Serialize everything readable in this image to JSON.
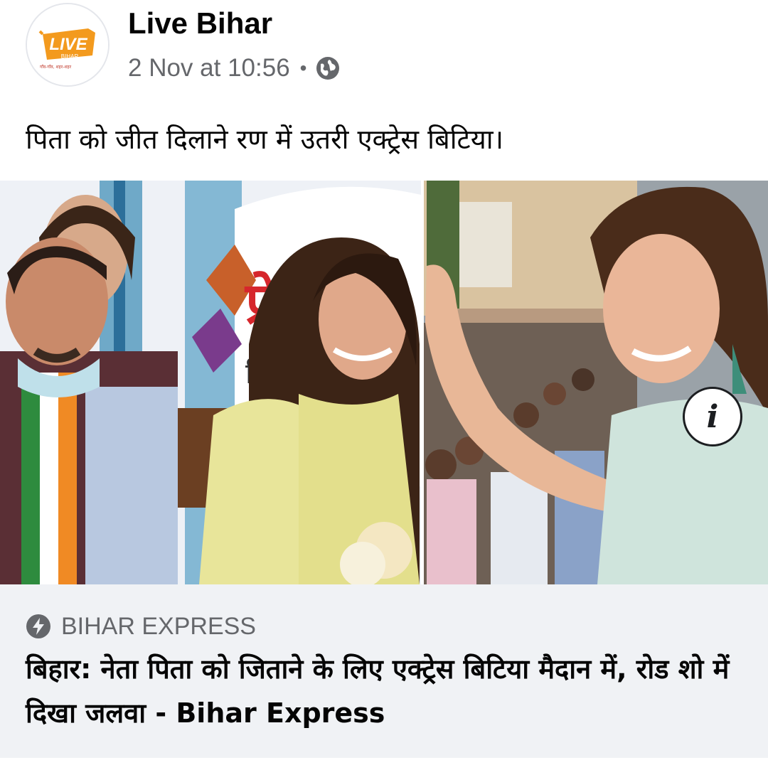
{
  "page": {
    "name": "Live Bihar",
    "timestamp": "2 Nov at 10:56",
    "separator": "•",
    "privacy_icon": "globe-icon",
    "logo_text": "LIVE",
    "logo_subtext": "BIHAR",
    "logo_tagline": "गाँव-गाँव, शहर-शहर"
  },
  "post": {
    "caption": "पिता को जीत दिलाने रण में उतरी एक्ट्रेस बिटिया।"
  },
  "media": {
    "info_button": "i"
  },
  "link": {
    "source_icon": "lightning-icon",
    "source": "BIHAR EXPRESS",
    "title": "बिहार: नेता पिता को जिताने के लिए एक्ट्रेस बिटिया मैदान में, रोड शो में दिखा जलवा - Bihar Express"
  },
  "colors": {
    "logo_orange": "#f39a1e",
    "link_bg": "#f0f2f5",
    "secondary_text": "#65676b"
  }
}
